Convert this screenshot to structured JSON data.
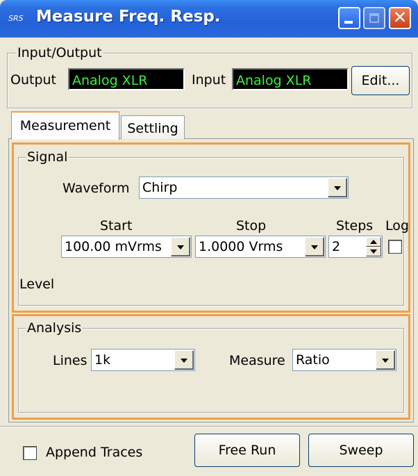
{
  "window": {
    "title": "Measure Freq. Resp.",
    "icon_text": "SRS"
  },
  "io_group": {
    "legend": "Input/Output",
    "output_label": "Output",
    "output_value": "Analog XLR",
    "input_label": "Input",
    "input_value": "Analog XLR",
    "edit_button": "Edit..."
  },
  "tabs": [
    {
      "label": "Measurement",
      "active": true
    },
    {
      "label": "Settling",
      "active": false
    }
  ],
  "signal": {
    "legend": "Signal",
    "waveform_label": "Waveform",
    "waveform_value": "Chirp",
    "start_label": "Start",
    "stop_label": "Stop",
    "steps_label": "Steps",
    "log_label": "Log",
    "start_value": "100.00 mVrms",
    "stop_value": "1.0000 Vrms",
    "steps_value": "2",
    "log_checked": false,
    "level_label": "Level"
  },
  "analysis": {
    "legend": "Analysis",
    "lines_label": "Lines",
    "lines_value": "1k",
    "measure_label": "Measure",
    "measure_value": "Ratio"
  },
  "footer": {
    "append_label": "Append Traces",
    "append_checked": false,
    "free_run_button": "Free Run",
    "sweep_button": "Sweep"
  },
  "colors": {
    "lcd_text": "#3cf040",
    "highlight_frame": "#f0a04a",
    "titlebar": "#2361d8"
  }
}
